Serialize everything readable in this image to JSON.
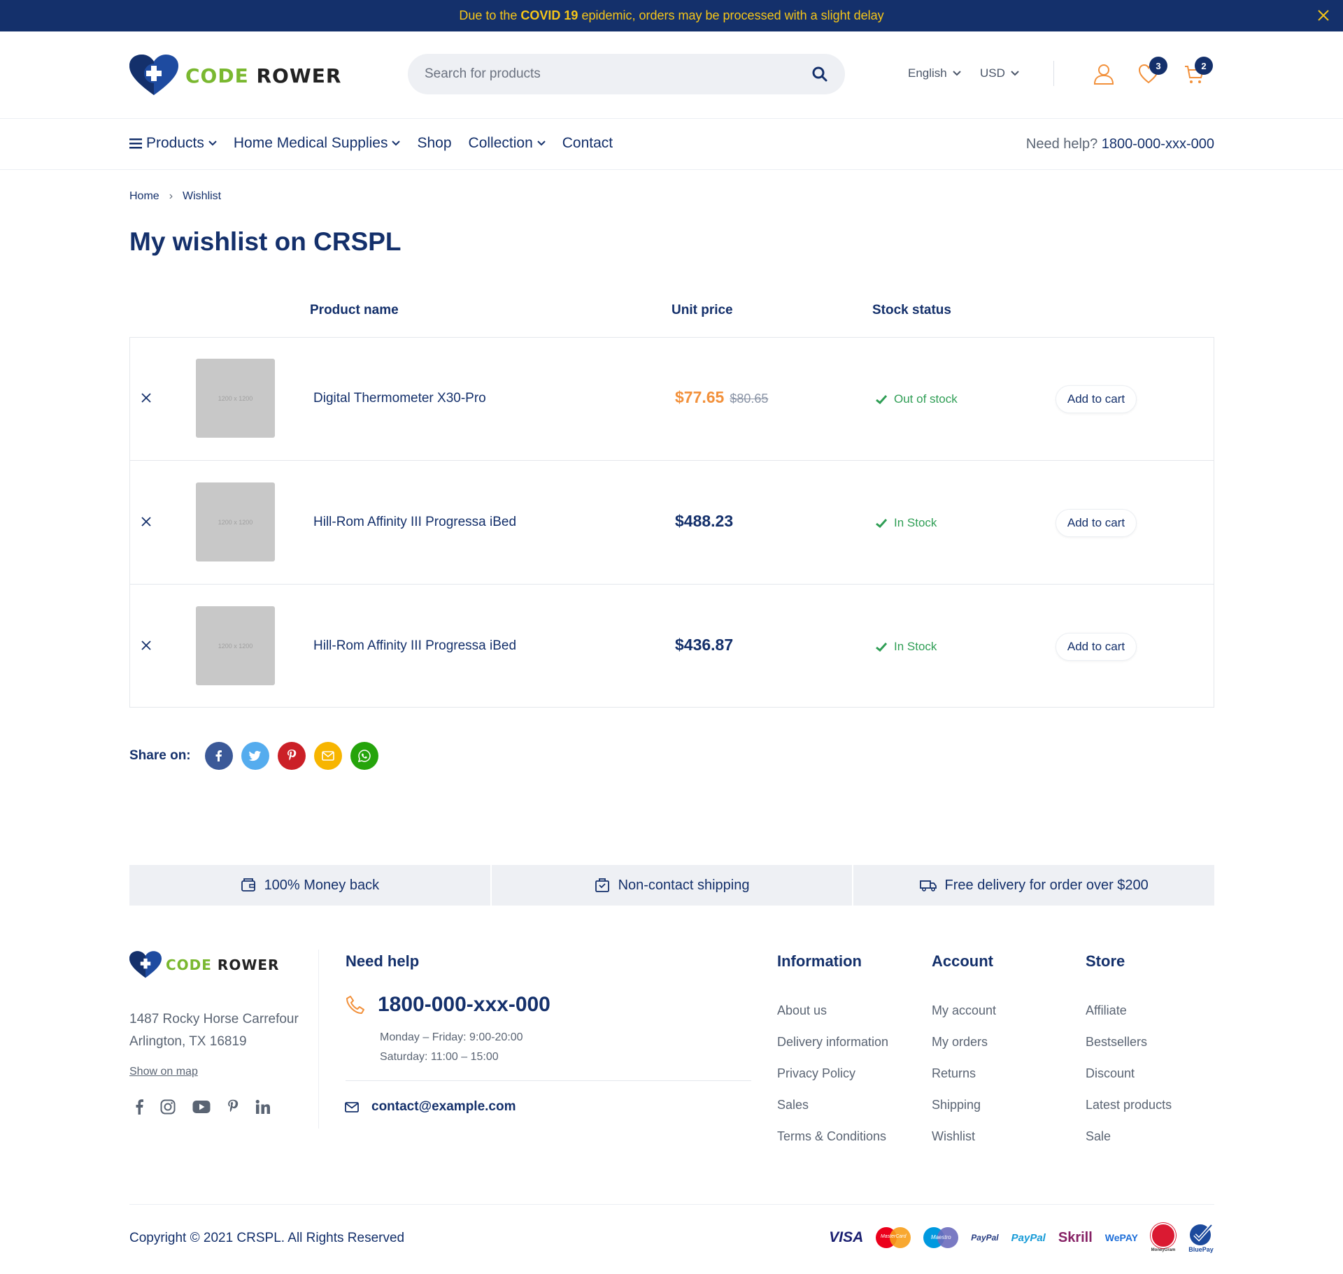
{
  "banner": {
    "prefix": "Due to the ",
    "highlight": "COVID 19",
    "suffix": " epidemic, orders may be processed with a slight delay"
  },
  "header": {
    "logo": {
      "part1": "CODE",
      "part2": "ROWER"
    },
    "search": {
      "placeholder": "Search for products"
    },
    "language": "English",
    "currency": "USD",
    "wishlist_count": "3",
    "cart_count": "2"
  },
  "nav": {
    "items": [
      "Products",
      "Home Medical Supplies",
      "Shop",
      "Collection",
      "Contact"
    ],
    "help_label": "Need help?",
    "help_phone": "1800-000-xxx-000"
  },
  "breadcrumb": {
    "home": "Home",
    "separator": "›",
    "current": "Wishlist"
  },
  "page_title": "My wishlist on CRSPL",
  "table": {
    "headers": {
      "name": "Product name",
      "price": "Unit price",
      "stock": "Stock status"
    },
    "rows": [
      {
        "image_label": "1200 x 1200",
        "name": "Digital Thermometer X30-Pro",
        "price": "$77.65",
        "old_price": "$80.65",
        "stock": "Out of stock",
        "action": "Add to cart"
      },
      {
        "image_label": "1200 x 1200",
        "name": "Hill-Rom Affinity III Progressa iBed",
        "price": "$488.23",
        "old_price": "",
        "stock": "In Stock",
        "action": "Add to cart"
      },
      {
        "image_label": "1200 x 1200",
        "name": "Hill-Rom Affinity III Progressa iBed",
        "price": "$436.87",
        "old_price": "",
        "stock": "In Stock",
        "action": "Add to cart"
      }
    ]
  },
  "share": {
    "label": "Share on:",
    "networks": [
      "facebook-icon",
      "twitter-icon",
      "pinterest-icon",
      "email-icon",
      "whatsapp-icon"
    ],
    "colors": [
      "#3b5998",
      "#55acee",
      "#cb2027",
      "#f7b500",
      "#25a40b"
    ]
  },
  "features": [
    "100% Money back",
    "Non-contact shipping",
    "Free delivery for order over $200"
  ],
  "footer": {
    "logo": {
      "part1": "CODE",
      "part2": "ROWER"
    },
    "address_line1": "1487 Rocky Horse Carrefour",
    "address_line2": "Arlington, TX 16819",
    "show_on_map": "Show on map",
    "social": [
      "facebook-icon",
      "instagram-icon",
      "youtube-icon",
      "pinterest-icon",
      "linkedin-icon"
    ],
    "need_help": {
      "title": "Need help",
      "phone": "1800-000-xxx-000",
      "hours1": "Monday – Friday: 9:00-20:00",
      "hours2": "Saturday: 11:00 – 15:00",
      "email": "contact@example.com"
    },
    "information": {
      "title": "Information",
      "links": [
        "About us",
        "Delivery information",
        "Privacy Policy",
        "Sales",
        "Terms & Conditions"
      ]
    },
    "account": {
      "title": "Account",
      "links": [
        "My account",
        "My orders",
        "Returns",
        "Shipping",
        "Wishlist"
      ]
    },
    "store": {
      "title": "Store",
      "links": [
        "Affiliate",
        "Bestsellers",
        "Discount",
        "Latest products",
        "Sale"
      ]
    },
    "copyright": "Copyright © 2021 CRSPL. All Rights Reserved",
    "payments": [
      "VISA",
      "MasterCard",
      "Maestro",
      "PayPal",
      "PayPal",
      "Skrill",
      "WePAY",
      "MoneyGram",
      "BluePay"
    ]
  },
  "colors": {
    "primary": "#14306b",
    "accent": "#f2903a",
    "banner_text": "#f5c518",
    "in_stock": "#2f9e55",
    "logo_green": "#7ab830"
  }
}
